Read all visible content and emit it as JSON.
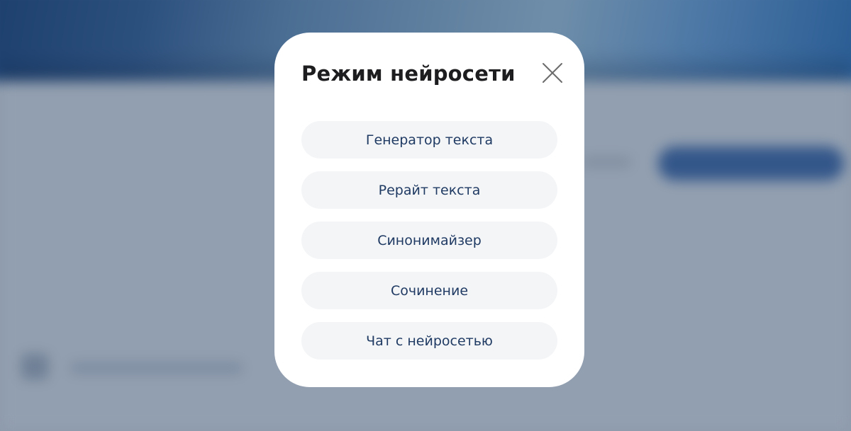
{
  "modal": {
    "title": "Режим нейросети",
    "close_icon": "close-icon",
    "options": [
      {
        "label": "Генератор текста"
      },
      {
        "label": "Рерайт текста"
      },
      {
        "label": "Синонимайзер"
      },
      {
        "label": "Сочинение"
      },
      {
        "label": "Чат с нейросетью"
      }
    ]
  },
  "colors": {
    "modal_background": "#ffffff",
    "option_background": "#f4f5f7",
    "option_text": "#1f3a63",
    "title_text": "#1d1d1f",
    "overlay_background": "#929fb0",
    "background_accent": "#34578a"
  }
}
